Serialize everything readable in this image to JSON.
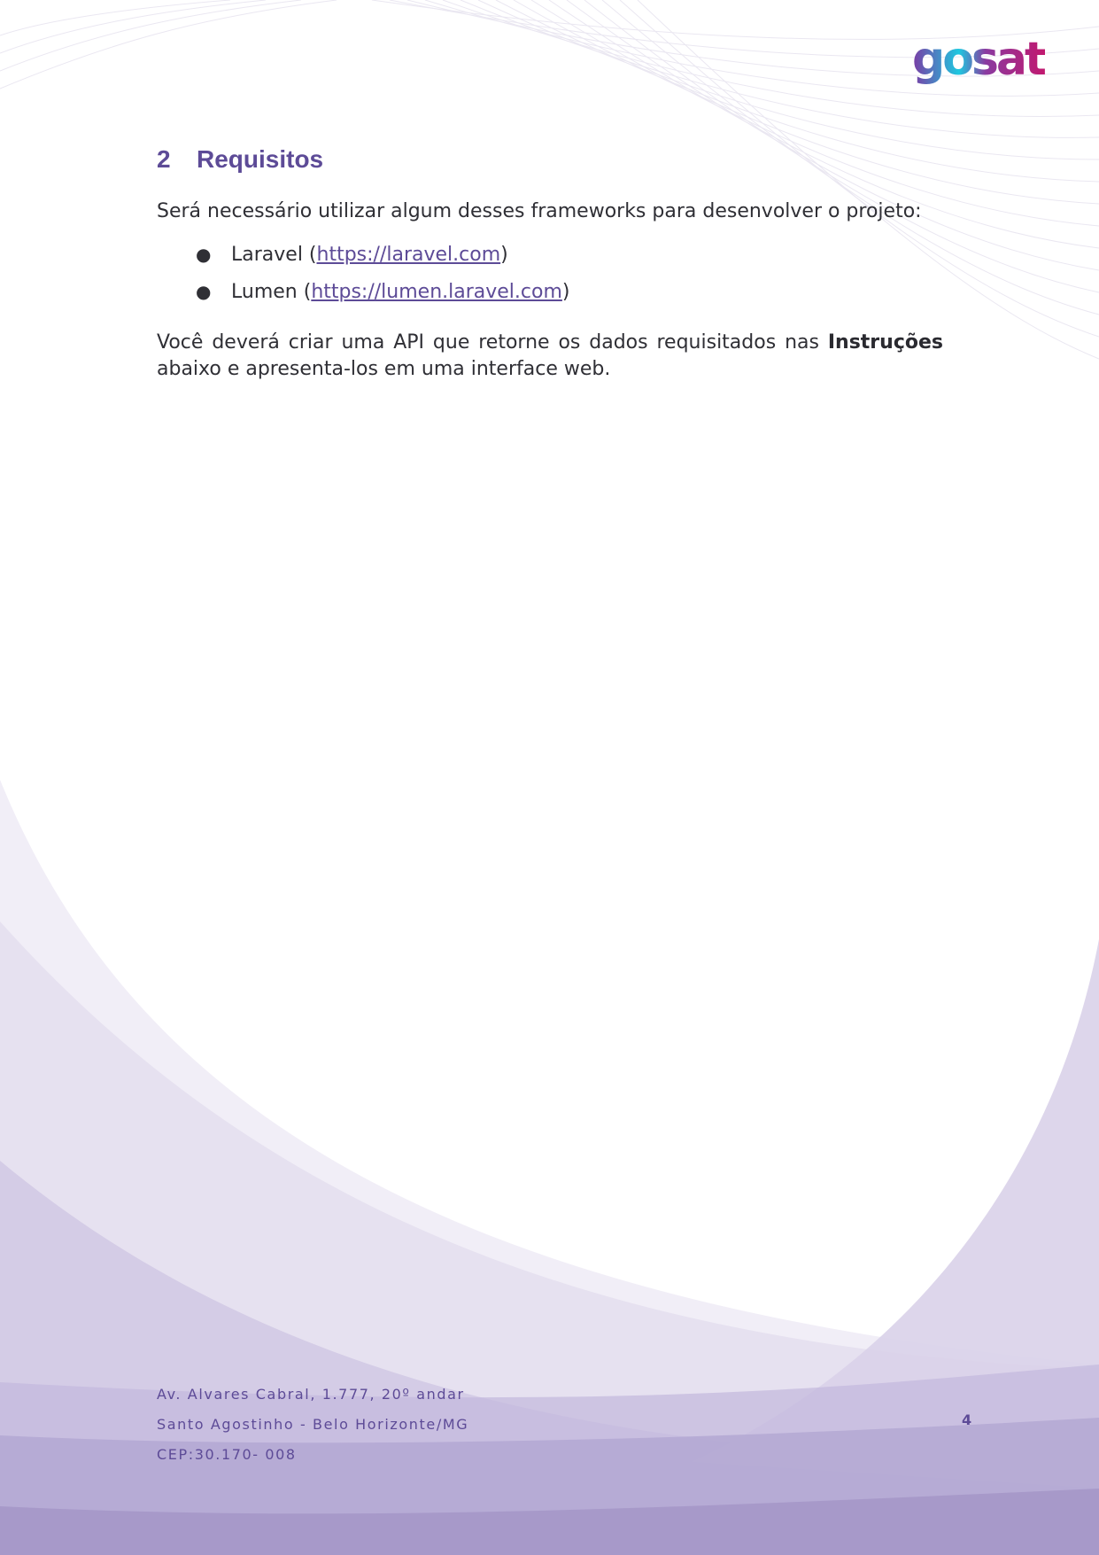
{
  "brand": {
    "logo_text": "gosat",
    "primary_color": "#5d4b97",
    "logo_gradient": [
      "#1ec8e0",
      "#7b3aa4",
      "#c2186e"
    ]
  },
  "section": {
    "number": "2",
    "title": "Requisitos"
  },
  "intro": "Será necessário utilizar algum desses frameworks para desenvolver o projeto:",
  "frameworks": [
    {
      "name": "Laravel (",
      "url": "https://laravel.com",
      "close": ")"
    },
    {
      "name": "Lumen (",
      "url": "https://lumen.laravel.com",
      "close": ")"
    }
  ],
  "api_paragraph": {
    "before": "Você deverá criar uma API que retorne os dados requisitados nas ",
    "bold": "Instruções",
    "after": " abaixo e apresenta-los em uma interface web."
  },
  "footer": {
    "address_line1": "Av. Alvares Cabral, 1.777, 20º andar",
    "address_line2": "Santo Agostinho - Belo Horizonte/MG",
    "address_line3": "CEP:30.170- 008",
    "page_number": "4"
  }
}
